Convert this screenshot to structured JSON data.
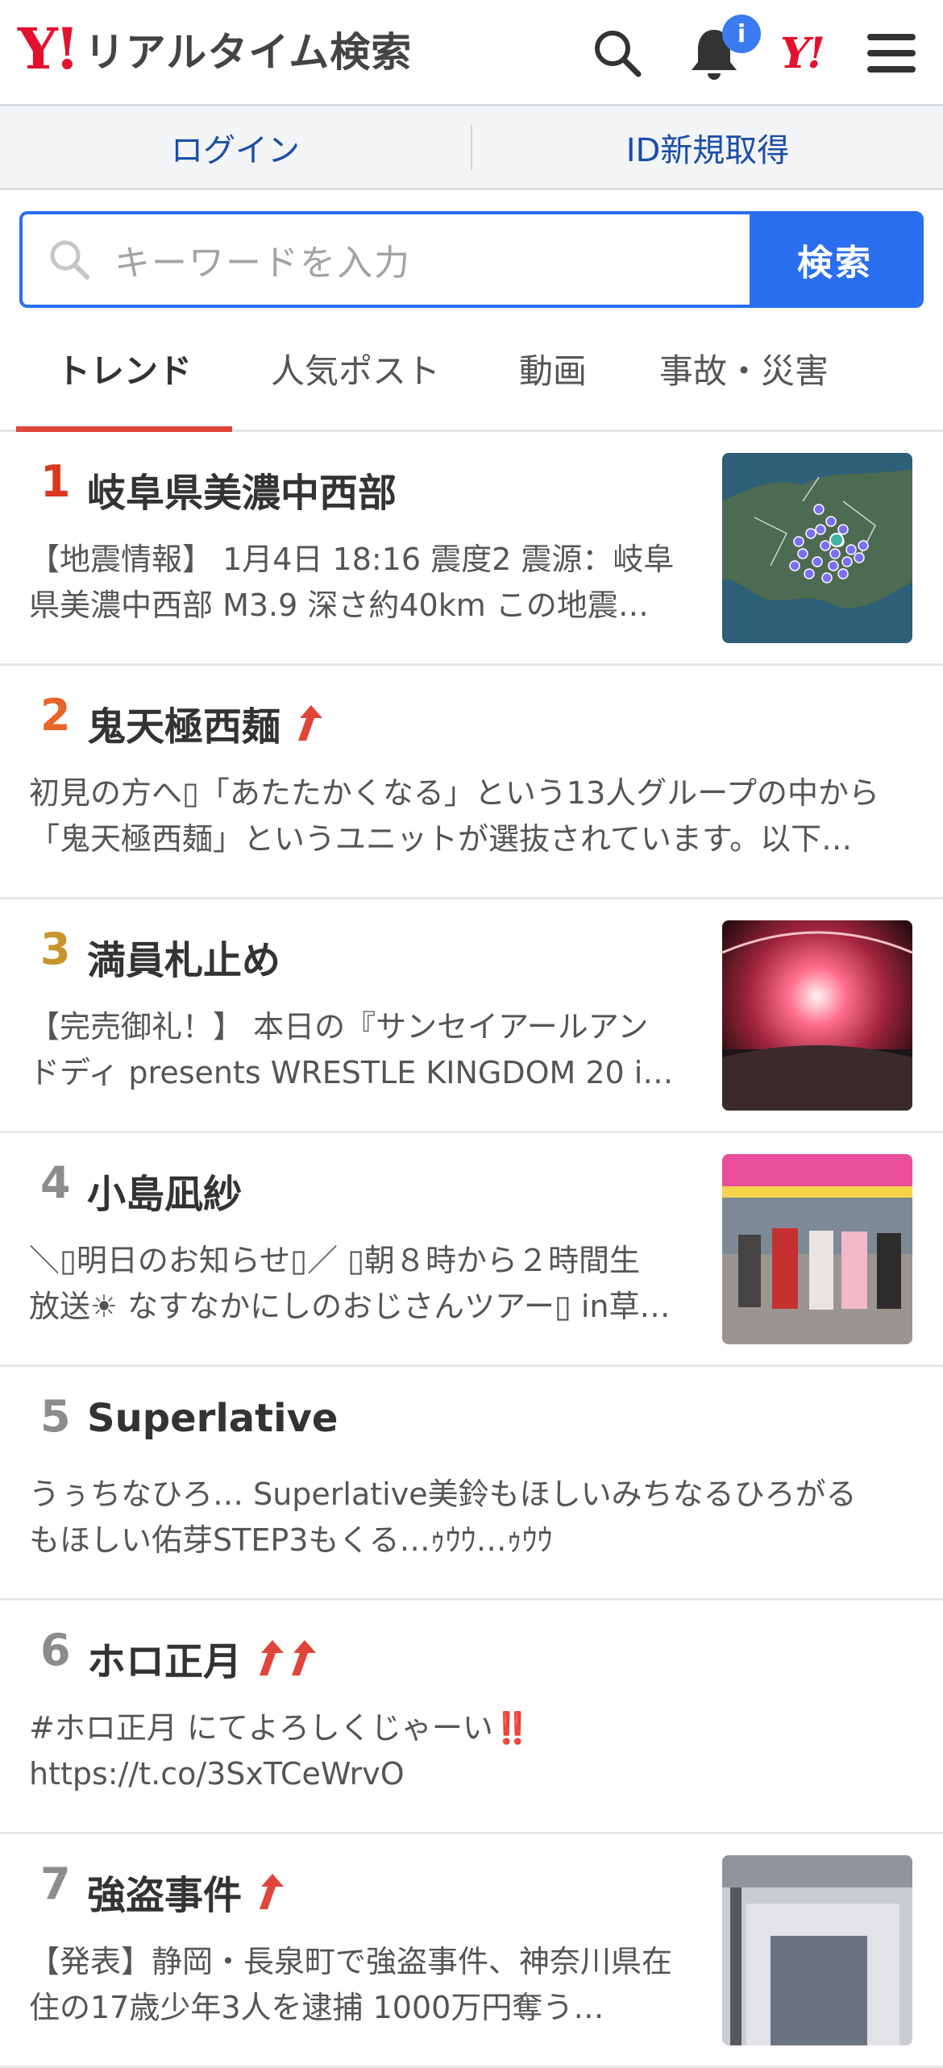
{
  "header": {
    "logo_y": "Y!",
    "logo_text": "リアルタイム検索",
    "icons": [
      "search-icon",
      "bell-icon",
      "yahoo-logo-icon",
      "menu-icon"
    ],
    "notification_badge": "i",
    "yahoo_mark": "Y!"
  },
  "auth": {
    "login": "ログイン",
    "register": "ID新規取得"
  },
  "search": {
    "placeholder": "キーワードを入力",
    "button": "検索"
  },
  "tabs": [
    {
      "label": "トレンド",
      "active": true
    },
    {
      "label": "人気ポスト",
      "active": false
    },
    {
      "label": "動画",
      "active": false
    },
    {
      "label": "事故・災害",
      "active": false
    }
  ],
  "colors": {
    "brand_red": "#e3112d",
    "accent_blue": "#2a6ef0",
    "tab_underline": "#e0453a",
    "trend_arrow": "#e0453a"
  },
  "trends": [
    {
      "rank": "1",
      "rank_color": "#d9381e",
      "title": "岐阜県美濃中西部",
      "arrows": 0,
      "line1": "【地震情報】 1月4日 18:16 震度2 震源：岐阜",
      "line2": "県美濃中西部 M3.9 深さ約40km この地震…",
      "thumb": "map"
    },
    {
      "rank": "2",
      "rank_color": "#e8652a",
      "title": "鬼天極西麺",
      "arrows": 1,
      "line1": "初見の方へ▯「あたたかくなる」という13人グループの中から",
      "line2": "「鬼天極西麺」というユニットが選抜されています。以下…",
      "thumb": ""
    },
    {
      "rank": "3",
      "rank_color": "#c7952a",
      "title": "満員札止め",
      "arrows": 0,
      "line1": "【完売御礼！】 本日の『サンセイアールアン",
      "line2": "ドディ presents WRESTLE KINGDOM 20 i…",
      "thumb": "arena"
    },
    {
      "rank": "4",
      "rank_color": "#8c8c8c",
      "title": "小島凪紗",
      "arrows": 0,
      "line1": "＼▯明日のお知らせ▯／ ▯朝８時から２時間生",
      "line2": "放送☀ なすなかにしのおじさんツアー▯ in草…",
      "thumb": "tv"
    },
    {
      "rank": "5",
      "rank_color": "#8c8c8c",
      "title": "Superlative",
      "arrows": 0,
      "line1": "うぅちなひろ… Superlative美鈴もほしいみちなるひろがる",
      "line2": "もほしい佑芽STEP3もくる…ｩｳｳ…ｩｳｳ",
      "thumb": ""
    },
    {
      "rank": "6",
      "rank_color": "#8c8c8c",
      "title": "ホロ正月",
      "arrows": 2,
      "line1": "#ホロ正月 にてよろしくじゃーい‼️",
      "line2": "https://t.co/3SxTCeWrvO",
      "thumb": ""
    },
    {
      "rank": "7",
      "rank_color": "#8c8c8c",
      "title": "強盗事件",
      "arrows": 1,
      "line1": "【発表】静岡・長泉町で強盗事件、神奈川県在",
      "line2": "住の17歳少年3人を逮捕 1000万円奪う…",
      "thumb": "building"
    }
  ]
}
